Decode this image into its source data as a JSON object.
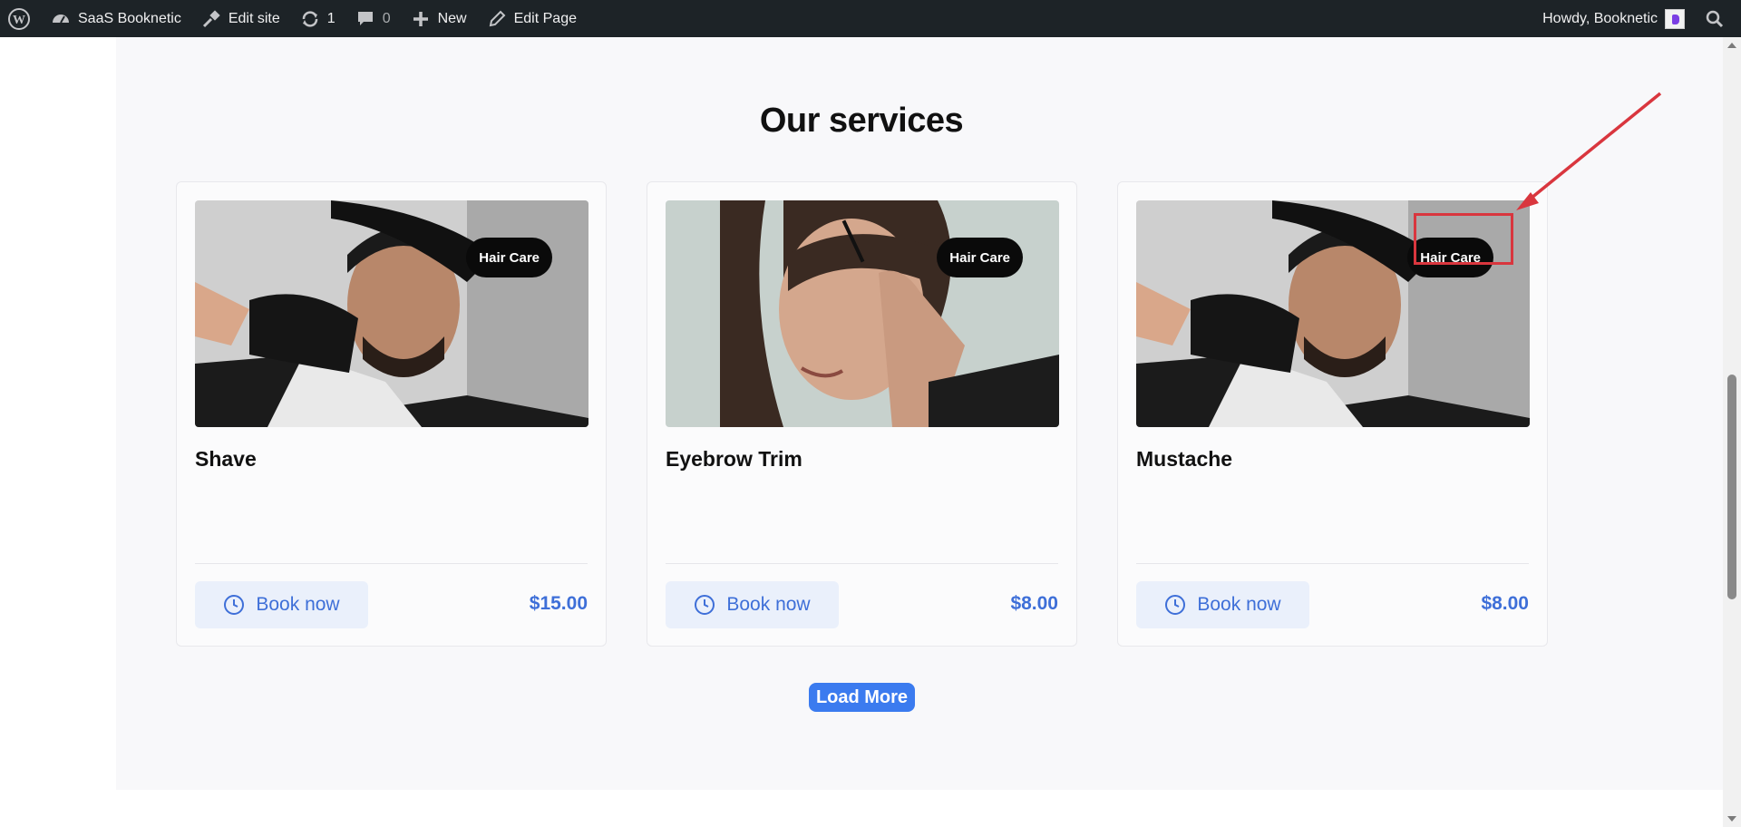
{
  "adminbar": {
    "site_name": "SaaS Booknetic",
    "edit_site": "Edit site",
    "updates_count": "1",
    "comments_count": "0",
    "new_label": "New",
    "edit_page": "Edit Page",
    "howdy": "Howdy, Booknetic"
  },
  "section": {
    "title": "Our services"
  },
  "services": [
    {
      "name": "Shave",
      "badge": "Hair Care",
      "book_label": "Book now",
      "price": "$15.00"
    },
    {
      "name": "Eyebrow Trim",
      "badge": "Hair Care",
      "book_label": "Book now",
      "price": "$8.00"
    },
    {
      "name": "Mustache",
      "badge": "Hair Care",
      "book_label": "Book now",
      "price": "$8.00"
    }
  ],
  "load_more": "Load More",
  "colors": {
    "accent": "#3e6fd8",
    "button": "#3b7bef",
    "annotation": "#d9363e",
    "adminbar": "#1d2327"
  }
}
